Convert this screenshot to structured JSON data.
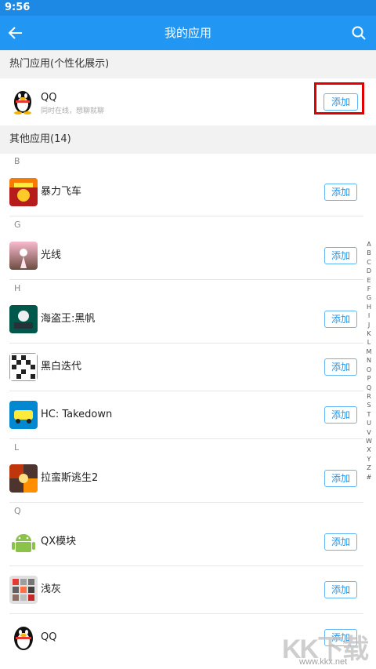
{
  "status": {
    "time": "9:56"
  },
  "toolbar": {
    "title": "我的应用"
  },
  "hot_section": {
    "header": "热门应用(个性化展示)",
    "app": {
      "name": "QQ",
      "subtitle": "同时在线，想聊就聊",
      "add_label": "添加"
    }
  },
  "other_section": {
    "header": "其他应用(14)"
  },
  "groups": [
    {
      "letter": "B",
      "apps": [
        {
          "name": "暴力飞车",
          "add_label": "添加"
        }
      ]
    },
    {
      "letter": "G",
      "apps": [
        {
          "name": "光线",
          "add_label": "添加"
        }
      ]
    },
    {
      "letter": "H",
      "apps": [
        {
          "name": "海盗王:黑帆",
          "add_label": "添加"
        },
        {
          "name": "黑白迭代",
          "add_label": "添加"
        },
        {
          "name": "HC: Takedown",
          "add_label": "添加"
        }
      ]
    },
    {
      "letter": "L",
      "apps": [
        {
          "name": "拉蛮斯逃生2",
          "add_label": "添加"
        }
      ]
    },
    {
      "letter": "Q",
      "apps": [
        {
          "name": "QX模块",
          "add_label": "添加"
        },
        {
          "name": "浅灰",
          "add_label": "添加"
        },
        {
          "name": "QQ",
          "add_label": "添加"
        }
      ]
    }
  ],
  "alphabet_index": [
    "A",
    "B",
    "C",
    "D",
    "E",
    "F",
    "G",
    "H",
    "I",
    "J",
    "K",
    "L",
    "M",
    "N",
    "O",
    "P",
    "Q",
    "R",
    "S",
    "T",
    "U",
    "V",
    "W",
    "X",
    "Y",
    "Z",
    "#"
  ],
  "watermark": {
    "logo": "KK下载",
    "url": "www.kkx.net"
  },
  "colors": {
    "toolbar": "#2196f3",
    "accent": "#2196f3",
    "highlight": "#e00000"
  }
}
